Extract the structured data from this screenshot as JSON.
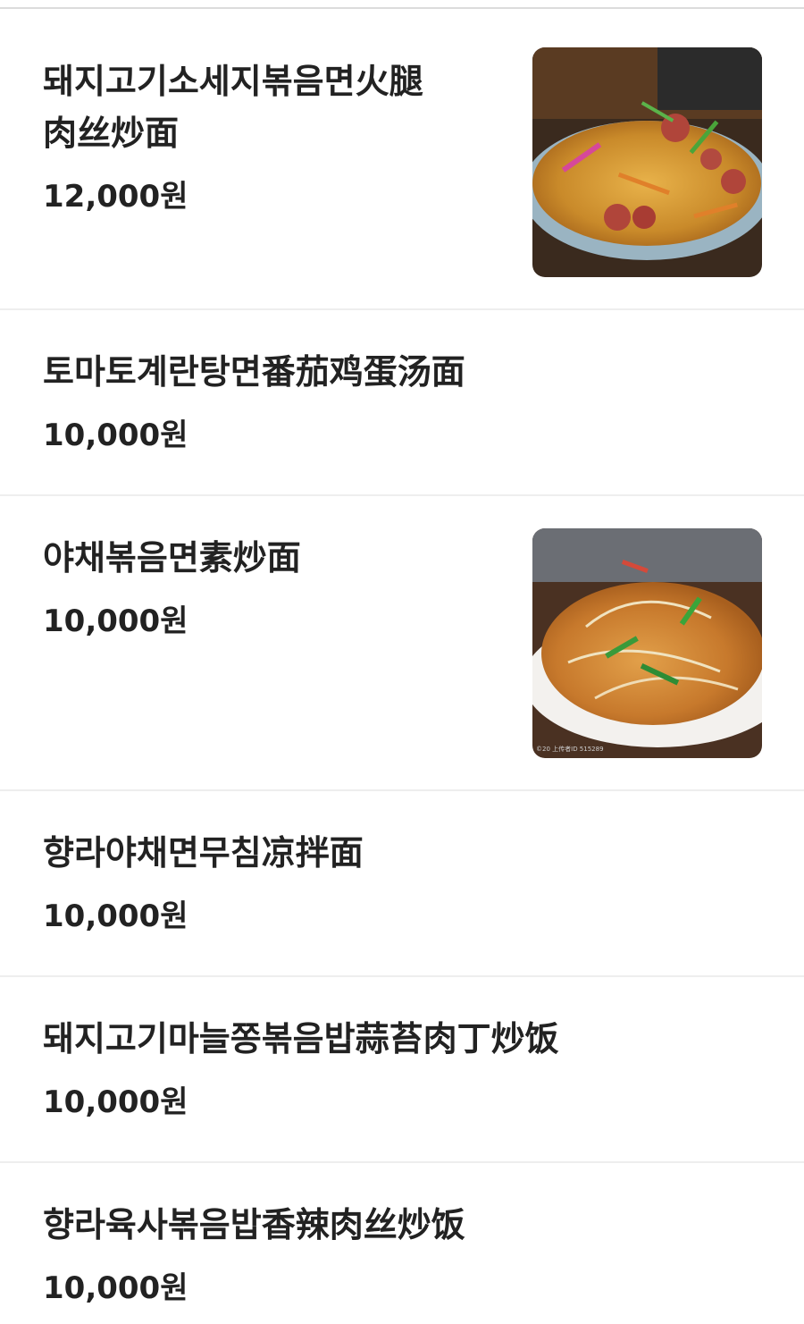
{
  "menu": {
    "items": [
      {
        "name_line1": "돼지고기소세지볶음면火腿",
        "name_line2": "肉丝炒面",
        "price": "12,000원",
        "image": "fried-noodles-with-ham-photo"
      },
      {
        "name_line1": "토마토계란탕면番茄鸡蛋汤面",
        "price": "10,000원"
      },
      {
        "name_line1": "야채볶음면素炒面",
        "price": "10,000원",
        "image": "vegetable-fried-noodles-photo"
      },
      {
        "name_line1": "향라야채면무침凉拌面",
        "price": "10,000원"
      },
      {
        "name_line1": "돼지고기마늘쫑볶음밥蒜苔肉丁炒饭",
        "price": "10,000원"
      },
      {
        "name_line1": "향라육사볶음밥香辣肉丝炒饭",
        "price": "10,000원"
      }
    ]
  }
}
